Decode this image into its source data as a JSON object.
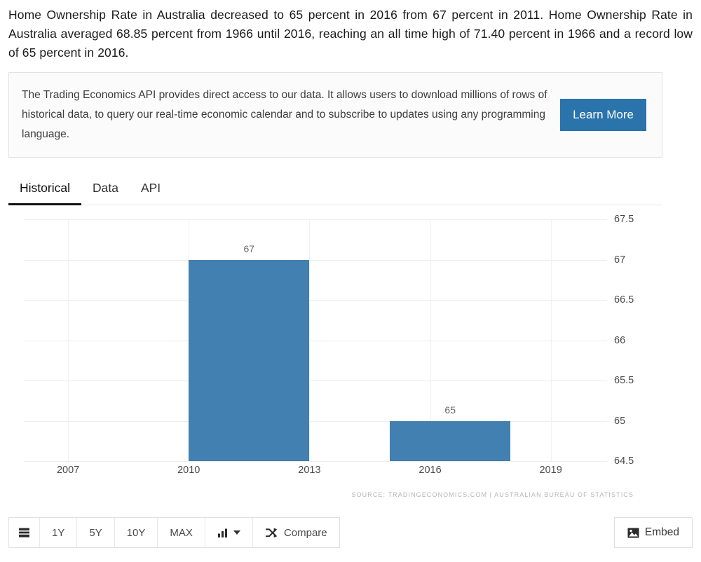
{
  "intro": {
    "paragraph": "Home Ownership Rate in Australia decreased to 65 percent in 2016 from 67 percent in 2011. Home Ownership Rate in Australia averaged 68.85 percent from 1966 until 2016, reaching an all time high of 71.40 percent in 1966 and a record low of 65 percent in 2016."
  },
  "api_box": {
    "text": "The Trading Economics API provides direct access to our data. It allows users to download millions of rows of historical data, to query our real-time economic calendar and to subscribe to updates using any programming language.",
    "button_label": "Learn More",
    "button_color": "#2a74ab"
  },
  "tabs": [
    {
      "label": "Historical",
      "active": true
    },
    {
      "label": "Data",
      "active": false
    },
    {
      "label": "API",
      "active": false
    }
  ],
  "chart_data": {
    "type": "bar",
    "title": "",
    "xlabel": "",
    "ylabel": "",
    "categories": [
      "2011",
      "2016"
    ],
    "values": [
      67,
      65
    ],
    "bar_labels": [
      "67",
      "65"
    ],
    "ylim": [
      64.5,
      67.5
    ],
    "yticks": [
      "67.5",
      "67",
      "66.5",
      "66",
      "65.5",
      "65",
      "64.5"
    ],
    "ytick_values": [
      67.5,
      67,
      66.5,
      66,
      65.5,
      65,
      64.5
    ],
    "xticks": [
      "2007",
      "2010",
      "2013",
      "2016",
      "2019"
    ],
    "xtick_values": [
      2007,
      2010,
      2013,
      2016,
      2019
    ],
    "grid": true,
    "legend": false,
    "series_color": "#4180b0",
    "source": "SOURCE: TRADINGECONOMICS.COM  |  AUSTRALIAN BUREAU OF STATISTICS"
  },
  "toolbar": {
    "calendar_icon": "calendar-icon",
    "ranges": [
      "1Y",
      "5Y",
      "10Y",
      "MAX"
    ],
    "chart_type_icon": "bar-chart-icon",
    "compare_label": "Compare",
    "compare_icon": "shuffle-icon",
    "embed_label": "Embed",
    "embed_icon": "image-icon"
  }
}
